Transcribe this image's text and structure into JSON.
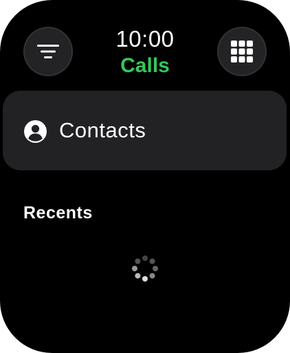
{
  "status": {
    "time": "10:00"
  },
  "header": {
    "title": "Calls",
    "title_color": "#35c759",
    "left_button_icon": "filter-lines-icon",
    "right_button_icon": "keypad-icon"
  },
  "contacts": {
    "label": "Contacts",
    "icon": "person-circle-icon"
  },
  "recents": {
    "header": "Recents",
    "loading": true
  }
}
